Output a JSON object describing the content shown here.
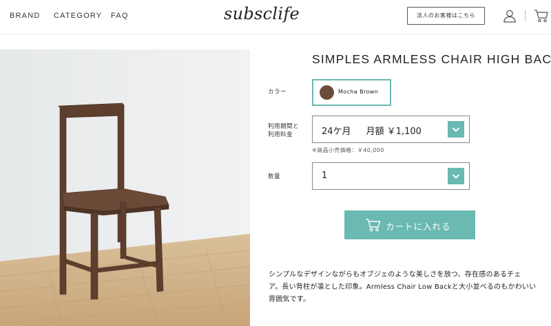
{
  "header": {
    "nav": [
      "BRAND",
      "CATEGORY",
      "FAQ"
    ],
    "logo": "subsclife",
    "corporate_button": "法人のお客様はこちら",
    "user_icon": "user-icon",
    "cart_icon": "cart-icon"
  },
  "product": {
    "title": "SIMPLES ARMLESS CHAIR HIGH BACK",
    "image_icon": "armless-chair-photo"
  },
  "options": {
    "color_label": "カラー",
    "color_value": "Mocha Brown",
    "color_swatch": "#6b4c3c",
    "period_label_1": "利用期間と",
    "period_label_2": "利用料金",
    "period_term": "24ケ月",
    "period_price": "月額 ￥1,100",
    "retail_note": "※商品小売価格：￥40,000",
    "quantity_label": "数量",
    "quantity_value": "1"
  },
  "cart_button": {
    "label": "カートに入れる",
    "icon": "cart-icon"
  },
  "description": {
    "lines": [
      "シンプルなデザインながらもオブジェのような美しさを放つ、存在感のあるチェ",
      "ア。長い背柱が凛とした印象。Armless Chair Low Backと大小並べるのもかわいい",
      "雰囲気です。"
    ]
  },
  "colors": {
    "accent": "#6ab9b2",
    "border": "#888888",
    "text": "#222222"
  }
}
